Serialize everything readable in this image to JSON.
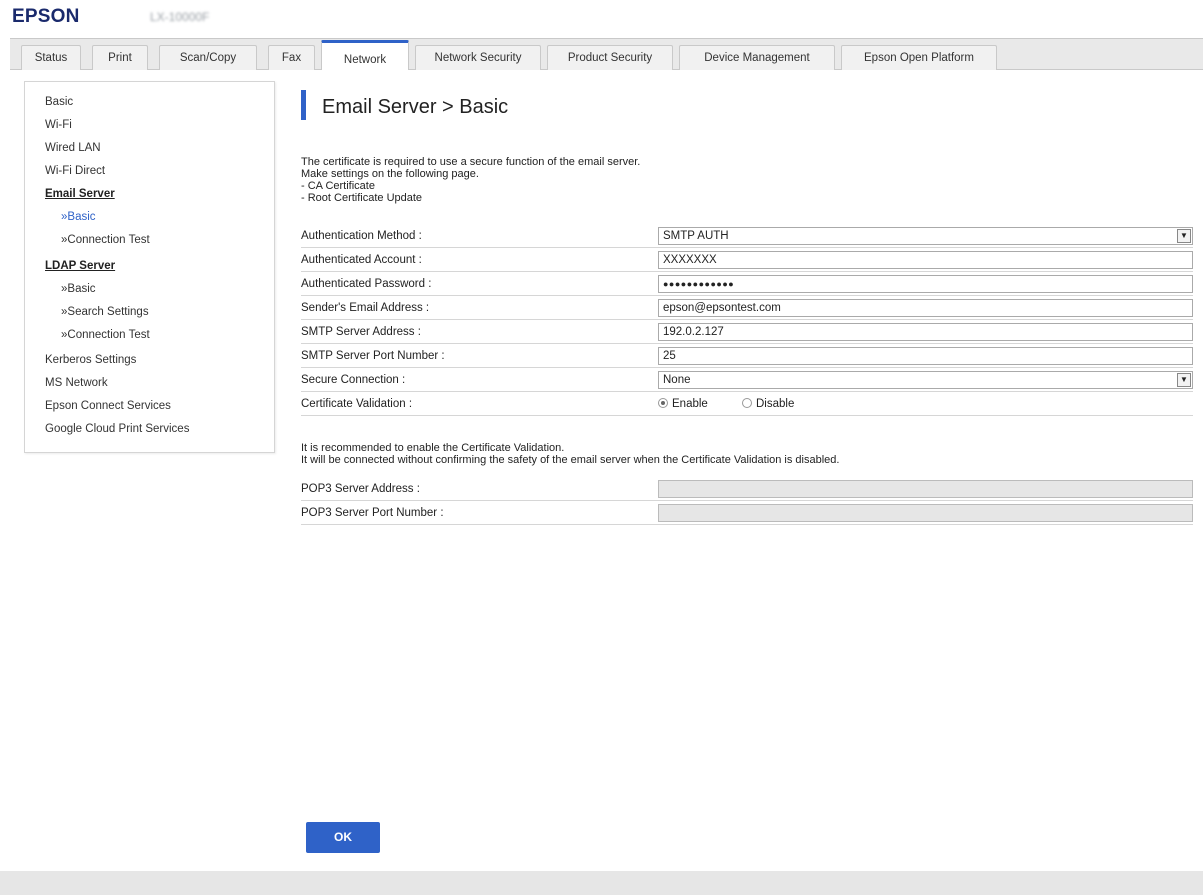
{
  "header": {
    "logo": "EPSON",
    "model": "LX-10000F"
  },
  "tabs": [
    {
      "label": "Status"
    },
    {
      "label": "Print"
    },
    {
      "label": "Scan/Copy"
    },
    {
      "label": "Fax"
    },
    {
      "label": "Network"
    },
    {
      "label": "Network Security"
    },
    {
      "label": "Product Security"
    },
    {
      "label": "Device Management"
    },
    {
      "label": "Epson Open Platform"
    }
  ],
  "sidebar": {
    "items": [
      {
        "label": "Basic"
      },
      {
        "label": "Wi-Fi"
      },
      {
        "label": "Wired LAN"
      },
      {
        "label": "Wi-Fi Direct"
      },
      {
        "label": "Email Server"
      },
      {
        "label": "»Basic"
      },
      {
        "label": "»Connection Test"
      },
      {
        "label": "LDAP Server"
      },
      {
        "label": "»Basic"
      },
      {
        "label": "»Search Settings"
      },
      {
        "label": "»Connection Test"
      },
      {
        "label": "Kerberos Settings"
      },
      {
        "label": "MS Network"
      },
      {
        "label": "Epson Connect Services"
      },
      {
        "label": "Google Cloud Print Services"
      }
    ]
  },
  "main": {
    "title": "Email Server > Basic",
    "notice": [
      "The certificate is required to use a secure function of the email server.",
      "Make settings on the following page.",
      "- CA Certificate",
      "- Root Certificate Update"
    ],
    "fields": [
      {
        "label": "Authentication Method :",
        "value": "SMTP AUTH"
      },
      {
        "label": "Authenticated Account :",
        "value": "XXXXXXX"
      },
      {
        "label": "Authenticated Password :",
        "value": "●●●●●●●●●●●●"
      },
      {
        "label": "Sender's Email Address :",
        "value": "epson@epsontest.com"
      },
      {
        "label": "SMTP Server Address :",
        "value": "192.0.2.127"
      },
      {
        "label": "SMTP Server Port Number :",
        "value": "25"
      },
      {
        "label": "Secure Connection :",
        "value": "None"
      },
      {
        "label": "Certificate Validation :",
        "enable": "Enable",
        "disable": "Disable"
      }
    ],
    "recommendation": [
      "It is recommended to enable the Certificate Validation.",
      "It will be connected without confirming the safety of the email server when the Certificate Validation is disabled."
    ],
    "pop3": [
      {
        "label": "POP3 Server Address :",
        "value": ""
      },
      {
        "label": "POP3 Server Port Number :",
        "value": ""
      }
    ],
    "ok_label": "OK"
  },
  "colors": {
    "accent": "#2f62c8",
    "logo": "#1a2a6c"
  },
  "icons": {
    "dropdown": "chevron-down-icon"
  }
}
